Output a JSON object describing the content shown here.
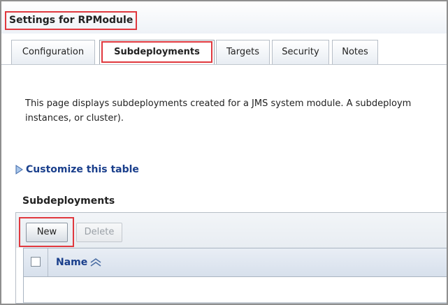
{
  "header": {
    "title": "Settings for RPModule"
  },
  "tabs": [
    {
      "label": "Configuration",
      "active": false
    },
    {
      "label": "Subdeployments",
      "active": true
    },
    {
      "label": "Targets",
      "active": false
    },
    {
      "label": "Security",
      "active": false
    },
    {
      "label": "Notes",
      "active": false
    }
  ],
  "description": {
    "line1": "This page displays subdeployments created for a JMS system module. A subdeploym",
    "line2": "instances, or cluster)."
  },
  "customize": {
    "label": "Customize this table",
    "icon": "triangle-right-icon"
  },
  "table": {
    "title": "Subdeployments",
    "buttons": {
      "new_label": "New",
      "delete_label": "Delete"
    },
    "columns": [
      {
        "label": "Name",
        "sort_icon": "sort-chevrons-icon"
      }
    ],
    "rows": []
  },
  "colors": {
    "accent_link": "#1a3f8c",
    "highlight_outline": "#e0383e"
  }
}
